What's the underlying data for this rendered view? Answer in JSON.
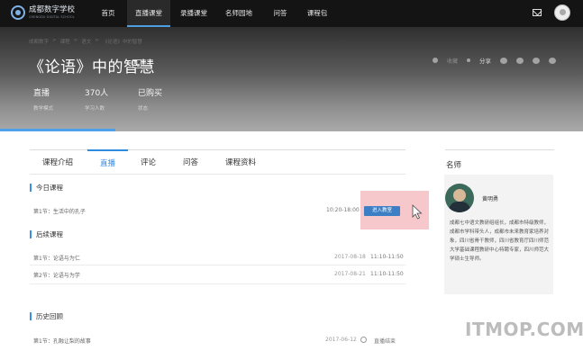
{
  "logo": {
    "name": "成都数字学校",
    "subtitle": "CHENGDU DIGITAL SCHOOL"
  },
  "nav": {
    "items": [
      "首页",
      "直播课堂",
      "录播课堂",
      "名师园地",
      "问答",
      "课程包"
    ],
    "active_index": 1
  },
  "breadcrumb": [
    "成都数字",
    "课程",
    "语文",
    "《论语》中的智慧"
  ],
  "course": {
    "title": "《论语》中的智慧",
    "qr_label": "二维码"
  },
  "share": {
    "label": "分享",
    "favorite": "收藏"
  },
  "stats": [
    {
      "value": "直播",
      "label": "教学模式"
    },
    {
      "value": "370人",
      "label": "学习人数"
    },
    {
      "value": "已购买",
      "label": "状态"
    }
  ],
  "tabs": [
    "课程介绍",
    "直播",
    "评论",
    "问答",
    "课程资料"
  ],
  "active_tab": 1,
  "today": {
    "title": "今日课程",
    "lesson": "第1节：生活中的孔子",
    "time": "10:20-18:00",
    "enter_label": "进入教室"
  },
  "upcoming": {
    "title": "后续课程",
    "rows": [
      {
        "lesson": "第1节：论语与为仁",
        "date": "2017-08-18",
        "time": "11:10-11:50"
      },
      {
        "lesson": "第2节：论语与为学",
        "date": "2017-08-21",
        "time": "11:10-11:50"
      }
    ]
  },
  "history": {
    "title": "历史回顾",
    "rows": [
      {
        "lesson": "第1节：孔融让梨的故事",
        "date": "2017-06-12",
        "status": "直播结束"
      }
    ]
  },
  "teacher": {
    "heading": "名师",
    "name": "黄明勇",
    "bio": "成都七中语文教研组组长，成都市特级教师，成都市学科带头人，成都市未来教育家培养对象，四川省骨干教师，四川省教育厅四川师范大学基础课程教研中心特聘专家，四川师范大学硕士生导师。"
  },
  "watermark": "ITMOP.COM",
  "colors": {
    "accent": "#2f8be0",
    "topbar": "#141414",
    "enter_button": "#3d7fc4",
    "highlight": "#f6c8cc"
  }
}
